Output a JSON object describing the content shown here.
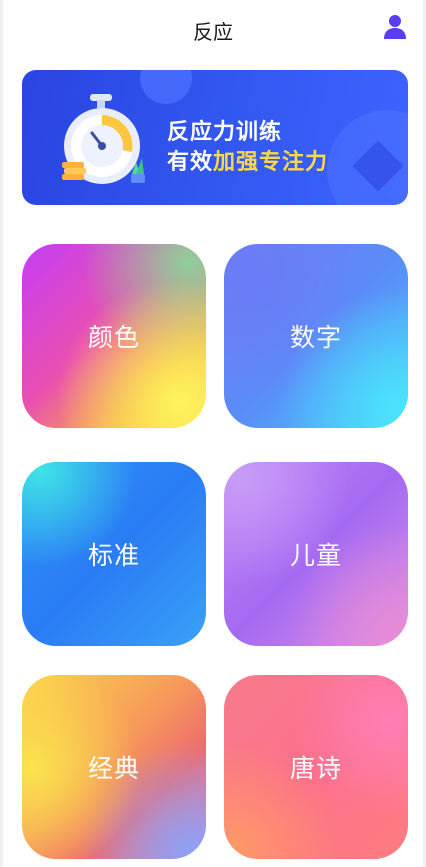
{
  "header": {
    "title": "反应",
    "user_icon": "user-icon",
    "accent_color": "#5b3df0"
  },
  "banner": {
    "line1": "反应力训练",
    "line2_prefix": "有效",
    "line2_highlight": "加强专注力",
    "illustration": "stopwatch-icon",
    "highlight_color": "#ffd84a"
  },
  "modes": [
    {
      "label": "颜色"
    },
    {
      "label": "数字"
    },
    {
      "label": "标准"
    },
    {
      "label": "儿童"
    },
    {
      "label": "经典"
    },
    {
      "label": "唐诗"
    }
  ]
}
